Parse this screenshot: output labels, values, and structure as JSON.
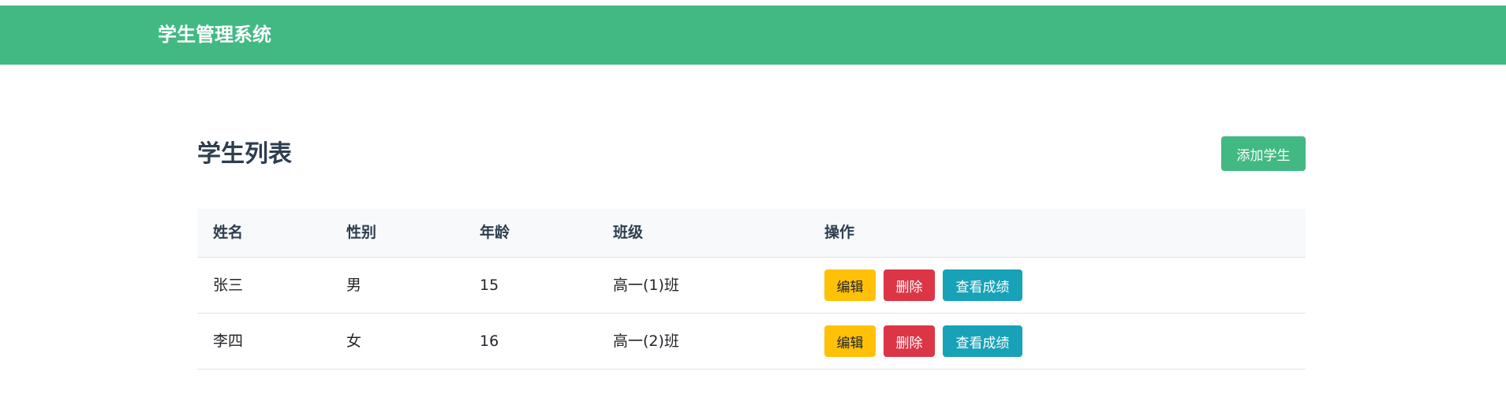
{
  "navbar": {
    "brand": "学生管理系统",
    "color": "#42b983"
  },
  "main": {
    "title": "学生列表",
    "add_button_label": "添加学生"
  },
  "table": {
    "headers": [
      "姓名",
      "性别",
      "年龄",
      "班级",
      "操作"
    ],
    "rows": [
      {
        "name": "张三",
        "gender": "男",
        "age": "15",
        "class": "高一(1)班",
        "actions": {
          "edit": "编辑",
          "delete": "删除",
          "grades": "查看成绩"
        }
      },
      {
        "name": "李四",
        "gender": "女",
        "age": "16",
        "class": "高一(2)班",
        "actions": {
          "edit": "编辑",
          "delete": "删除",
          "grades": "查看成绩"
        }
      }
    ]
  },
  "colors": {
    "primary": "#42b983",
    "edit": "#ffc107",
    "delete": "#dc3545",
    "grades": "#17a2b8"
  }
}
